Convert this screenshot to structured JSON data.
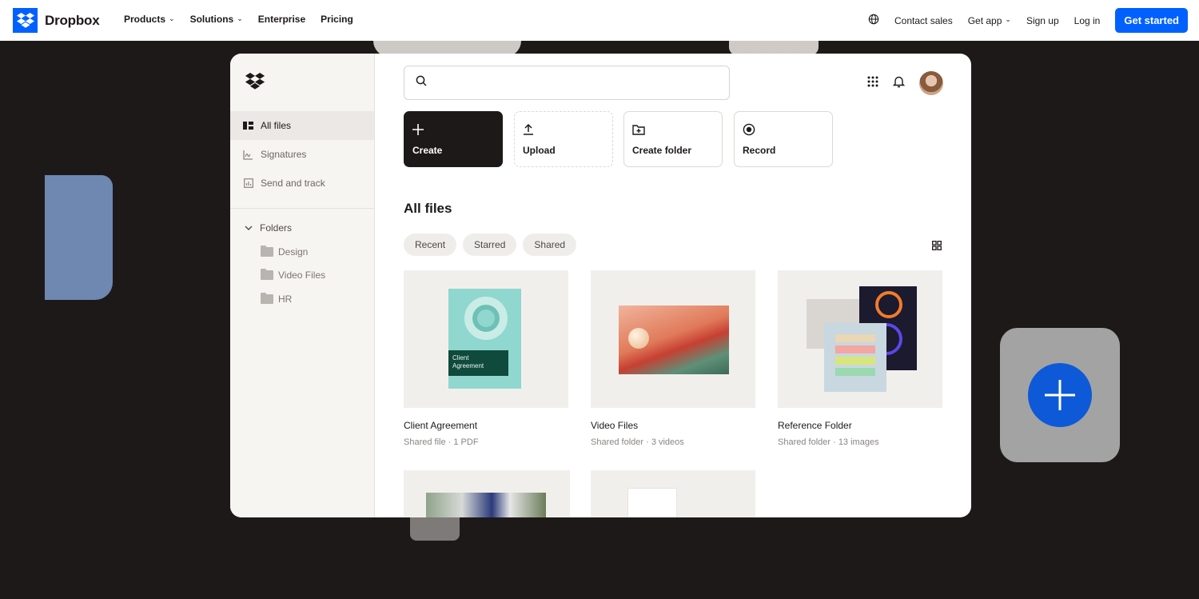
{
  "nav": {
    "brand": "Dropbox",
    "links": [
      {
        "label": "Products",
        "has_menu": true
      },
      {
        "label": "Solutions",
        "has_menu": true
      },
      {
        "label": "Enterprise",
        "has_menu": false
      },
      {
        "label": "Pricing",
        "has_menu": false
      }
    ],
    "contact": "Contact sales",
    "get_app": "Get app",
    "sign_up": "Sign up",
    "log_in": "Log in",
    "cta": "Get started"
  },
  "sidebar": {
    "items": [
      {
        "label": "All files",
        "icon": "files-icon",
        "active": true
      },
      {
        "label": "Signatures",
        "icon": "signature-icon",
        "active": false
      },
      {
        "label": "Send and track",
        "icon": "chart-icon",
        "active": false
      }
    ],
    "folders_label": "Folders",
    "folders": [
      "Design",
      "Video Files",
      "HR"
    ]
  },
  "actions": [
    {
      "label": "Create",
      "icon": "plus-icon"
    },
    {
      "label": "Upload",
      "icon": "upload-icon"
    },
    {
      "label": "Create folder",
      "icon": "folder-plus-icon"
    },
    {
      "label": "Record",
      "icon": "record-icon"
    }
  ],
  "main": {
    "title": "All files",
    "chips": [
      "Recent",
      "Starred",
      "Shared"
    ]
  },
  "files": [
    {
      "name": "Client Agreement",
      "meta": "Shared file · 1 PDF",
      "thumb_text": "Client\nAgreement"
    },
    {
      "name": "Video Files",
      "meta": "Shared folder · 3 videos"
    },
    {
      "name": "Reference Folder",
      "meta": "Shared folder · 13 images"
    }
  ],
  "colors": {
    "accent": "#0061fe",
    "dark": "#1e1919",
    "sidebar": "#f7f5f2"
  }
}
